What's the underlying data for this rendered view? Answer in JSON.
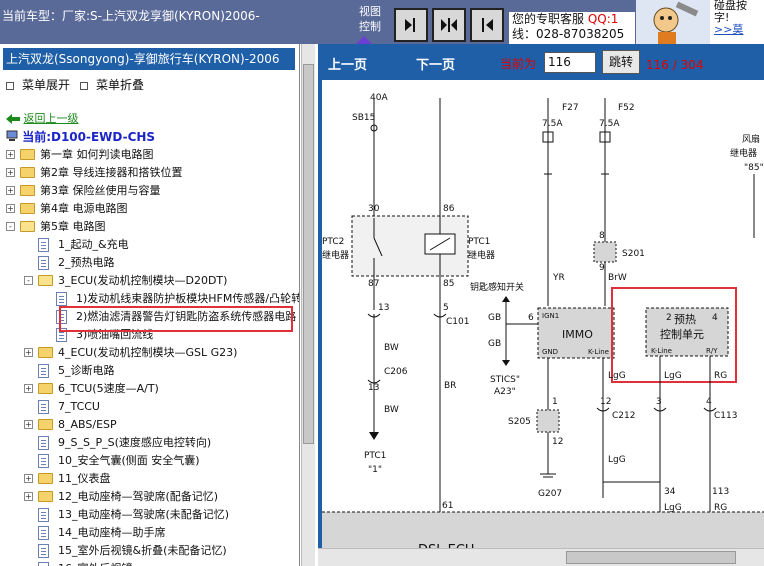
{
  "topbar": {
    "vehicle": "当前车型：厂家:S-上汽双龙享御(KYRON)2006-",
    "view_control": "视图控制",
    "view_buttons": [
      "prev-view",
      "split-view",
      "next-view"
    ],
    "service_line1": "您的专职客服",
    "service_qq": "QQ:1",
    "service_line2": "线：028-87038205",
    "help_line1": "碰盘按",
    "help_line2": "字!",
    "help_link": ">>莫"
  },
  "left": {
    "header": "上汽双龙(Ssongyong)-享御旅行车(KYRON)-2006",
    "expand_menu": "菜单展开",
    "collapse_menu": "菜单折叠",
    "back_link": "返回上一级",
    "current": "当前:D100-EWD-CHS",
    "tree": [
      {
        "label": "第一章 如何判读电路图",
        "kind": "folder",
        "level": 0,
        "expander": "+"
      },
      {
        "label": "第2章 导线连接器和搭铁位置",
        "kind": "folder",
        "level": 0,
        "expander": "+"
      },
      {
        "label": "第3章 保险丝使用与容量",
        "kind": "folder",
        "level": 0,
        "expander": "+"
      },
      {
        "label": "第4章 电源电路图",
        "kind": "folder",
        "level": 0,
        "expander": "+"
      },
      {
        "label": "第5章 电路图",
        "kind": "folder-open",
        "level": 0,
        "expander": "-"
      },
      {
        "label": "1_起动_&充电",
        "kind": "doc",
        "level": 1,
        "expander": ""
      },
      {
        "label": "2_预热电路",
        "kind": "doc",
        "level": 1,
        "expander": ""
      },
      {
        "label": "3_ECU(发动机控制模块—D20DT)",
        "kind": "folder-open",
        "level": 1,
        "expander": "-"
      },
      {
        "label": "1)发动机线束器防护板模块HFM传感器/凸轮转",
        "kind": "doc",
        "level": 2,
        "expander": ""
      },
      {
        "label": "2)燃油滤清器警告灯钥匙防盗系统传感器电路",
        "kind": "doc",
        "level": 2,
        "expander": ""
      },
      {
        "label": "3)喷油嘴回流线",
        "kind": "doc",
        "level": 2,
        "expander": ""
      },
      {
        "label": "4_ECU(发动机控制模块—GSL G23)",
        "kind": "folder",
        "level": 1,
        "expander": "+"
      },
      {
        "label": "5_诊断电路",
        "kind": "doc",
        "level": 1,
        "expander": ""
      },
      {
        "label": "6_TCU(5速度—A/T)",
        "kind": "folder",
        "level": 1,
        "expander": "+"
      },
      {
        "label": "7_TCCU",
        "kind": "doc",
        "level": 1,
        "expander": ""
      },
      {
        "label": "8_ABS/ESP",
        "kind": "folder",
        "level": 1,
        "expander": "+"
      },
      {
        "label": "9_S_S_P_S(速度感应电控转向)",
        "kind": "doc",
        "level": 1,
        "expander": ""
      },
      {
        "label": "10_安全气囊(侧面 安全气囊)",
        "kind": "doc",
        "level": 1,
        "expander": ""
      },
      {
        "label": "11_仪表盘",
        "kind": "folder",
        "level": 1,
        "expander": "+"
      },
      {
        "label": "12_电动座椅—驾驶席(配备记忆)",
        "kind": "folder",
        "level": 1,
        "expander": "+"
      },
      {
        "label": "13_电动座椅—驾驶席(未配备记忆)",
        "kind": "doc",
        "level": 1,
        "expander": ""
      },
      {
        "label": "14_电动座椅—助手席",
        "kind": "doc",
        "level": 1,
        "expander": ""
      },
      {
        "label": "15_室外后视镜&折叠(未配备记忆)",
        "kind": "doc",
        "level": 1,
        "expander": ""
      },
      {
        "label": "16_室外后视镜",
        "kind": "doc",
        "level": 1,
        "expander": ""
      }
    ]
  },
  "nav": {
    "prev": "上一页",
    "next": "下一页",
    "current_label": "当前为",
    "page_value": "116",
    "jump": "跳转",
    "page_count": "116 / 304"
  },
  "diagram": {
    "labels": {
      "f27": "F27",
      "f52": "F52",
      "amp1": "7.5A",
      "amp2": "7.5A",
      "sb15": "SB15",
      "amp40": "40A",
      "ptc2": "PTC2",
      "ptc2b": "继电器",
      "ptc1": "PTC1",
      "ptc1b": "继电器",
      "p30": "30",
      "p86": "86",
      "p87": "87",
      "p85": "85",
      "w13": "13",
      "w5": "5",
      "c101": "C101",
      "bw1": "BW",
      "c206": "C206",
      "w13b": "13",
      "bw2": "BW",
      "br": "BR",
      "ptc1bot": "PTC1",
      "ptc1q": "\"1\"",
      "key_sw": "钥匙感知开关",
      "gb1": "GB",
      "gb2": "GB",
      "p6": "6",
      "stics": "STICS\"",
      "a23": "A23\"",
      "yr": "YR",
      "brw": "BrW",
      "p8": "8",
      "p9": "9",
      "s201": "S201",
      "immo": "IMMO",
      "ign": "IGN1",
      "gnd": "GND",
      "kline": "K-Line",
      "pre1": "预热",
      "pre2": "控制单元",
      "kline2": "K-Line",
      "ry": "R/Y",
      "p2": "2",
      "p4": "4",
      "lgg": "LgG",
      "lgg2": "LgG",
      "rg": "RG",
      "c212": "C212",
      "p12": "12",
      "p3": "3",
      "p4b": "4",
      "c113": "C113",
      "s205": "S205",
      "p1": "1",
      "p12b": "12",
      "g207": "G207",
      "lgg3": "LgG",
      "lgg4": "LgG",
      "rg2": "RG",
      "p61": "61",
      "p34": "34",
      "p113": "113",
      "fan1": "风扇",
      "fan2": "继电器",
      "fan3": "\"85\"",
      "dsl": "DSL ECU"
    }
  }
}
